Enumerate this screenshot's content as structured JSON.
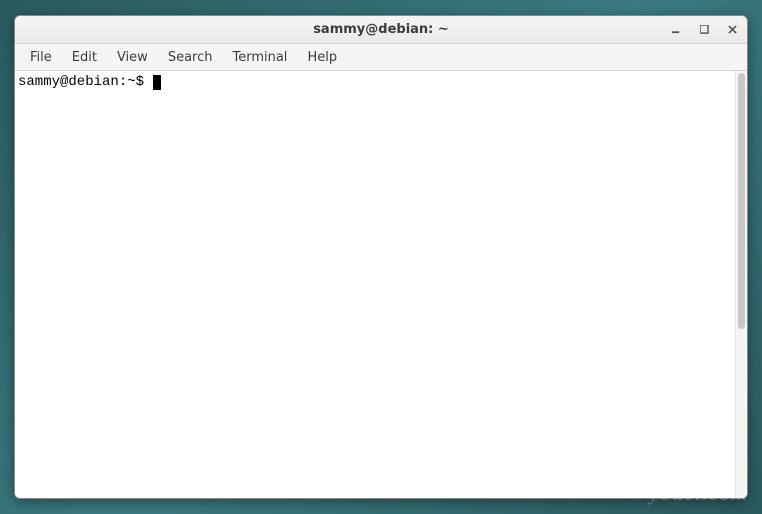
{
  "window": {
    "title": "sammy@debian: ~"
  },
  "menubar": {
    "items": [
      "File",
      "Edit",
      "View",
      "Search",
      "Terminal",
      "Help"
    ]
  },
  "terminal": {
    "prompt": "sammy@debian:~$ "
  },
  "watermark": "youcl.com"
}
